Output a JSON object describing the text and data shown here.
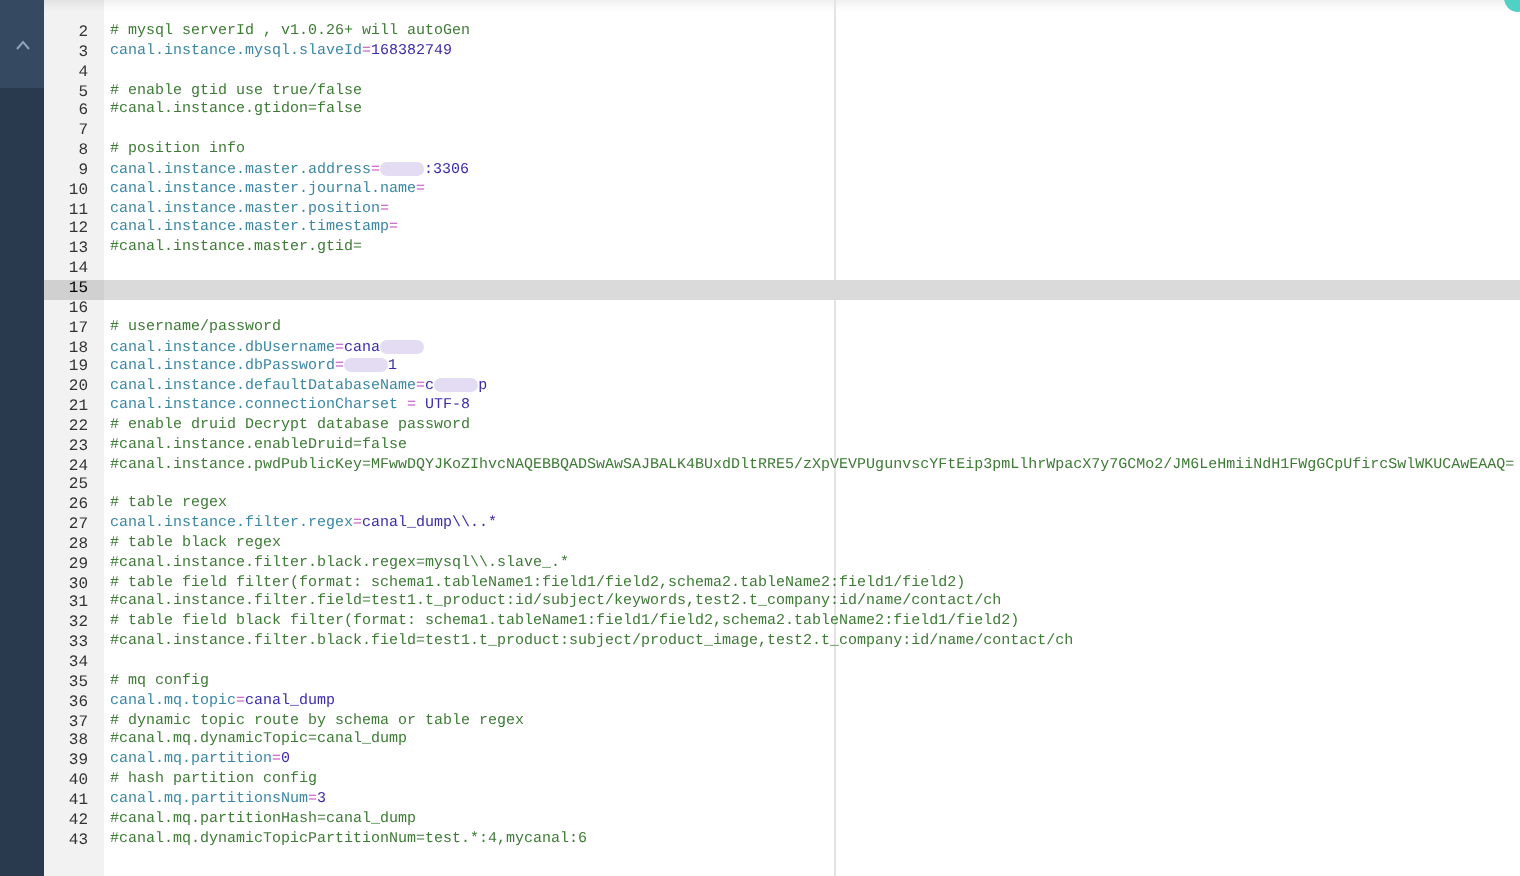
{
  "editor": {
    "lines": [
      {
        "number": "2",
        "kind": "comment",
        "text": "# mysql serverId , v1.0.26+ will autoGen",
        "selected": false
      },
      {
        "number": "3",
        "kind": "property",
        "key": "canal.instance.mysql.slaveId",
        "op": "=",
        "value": "168382749",
        "selected": false
      },
      {
        "number": "4",
        "kind": "blank",
        "selected": false
      },
      {
        "number": "5",
        "kind": "comment",
        "text": "# enable gtid use true/false",
        "selected": false
      },
      {
        "number": "6",
        "kind": "comment",
        "text": "#canal.instance.gtidon=false",
        "selected": false
      },
      {
        "number": "7",
        "kind": "blank",
        "selected": false
      },
      {
        "number": "8",
        "kind": "comment",
        "text": "# position info",
        "selected": false
      },
      {
        "number": "9",
        "kind": "property",
        "key": "canal.instance.master.address",
        "op": "=",
        "masked": true,
        "tail": ":3306",
        "selected": false
      },
      {
        "number": "10",
        "kind": "property",
        "key": "canal.instance.master.journal.name",
        "op": "=",
        "selected": false
      },
      {
        "number": "11",
        "kind": "property",
        "key": "canal.instance.master.position",
        "op": "=",
        "selected": false
      },
      {
        "number": "12",
        "kind": "property",
        "key": "canal.instance.master.timestamp",
        "op": "=",
        "selected": false
      },
      {
        "number": "13",
        "kind": "comment",
        "text": "#canal.instance.master.gtid=",
        "selected": false
      },
      {
        "number": "14",
        "kind": "blank",
        "selected": false
      },
      {
        "number": "15",
        "kind": "blank",
        "selected": true
      },
      {
        "number": "16",
        "kind": "blank",
        "selected": false
      },
      {
        "number": "17",
        "kind": "comment",
        "text": "# username/password",
        "selected": false
      },
      {
        "number": "18",
        "kind": "property",
        "key": "canal.instance.dbUsername",
        "op": "=",
        "value": "cana",
        "masked": true,
        "selected": false
      },
      {
        "number": "19",
        "kind": "property",
        "key": "canal.instance.dbPassword",
        "op": "=",
        "masked": true,
        "tail": "1",
        "selected": false
      },
      {
        "number": "20",
        "kind": "property",
        "key": "canal.instance.defaultDatabaseName",
        "op": "=",
        "value": "c",
        "masked": true,
        "tail": "p",
        "selected": false
      },
      {
        "number": "21",
        "kind": "property",
        "key": "canal.instance.connectionCharset",
        "op": " = ",
        "value": "UTF-8",
        "selected": false
      },
      {
        "number": "22",
        "kind": "comment",
        "text": "# enable druid Decrypt database password",
        "selected": false
      },
      {
        "number": "23",
        "kind": "comment",
        "text": "#canal.instance.enableDruid=false",
        "selected": false
      },
      {
        "number": "24",
        "kind": "comment",
        "text": "#canal.instance.pwdPublicKey=MFwwDQYJKoZIhvcNAQEBBQADSwAwSAJBALK4BUxdDltRRE5/zXpVEVPUgunvscYFtEip3pmLlhrWpacX7y7GCMo2/JM6LeHmiiNdH1FWgGCpUfircSwlWKUCAwEAAQ=",
        "selected": false
      },
      {
        "number": "25",
        "kind": "blank",
        "selected": false
      },
      {
        "number": "26",
        "kind": "comment",
        "text": "# table regex",
        "selected": false
      },
      {
        "number": "27",
        "kind": "property",
        "key": "canal.instance.filter.regex",
        "op": "=",
        "value": "canal_dump\\\\..*",
        "selected": false
      },
      {
        "number": "28",
        "kind": "comment",
        "text": "# table black regex",
        "selected": false
      },
      {
        "number": "29",
        "kind": "comment",
        "text": "#canal.instance.filter.black.regex=mysql\\\\.slave_.*",
        "selected": false
      },
      {
        "number": "30",
        "kind": "comment",
        "text": "# table field filter(format: schema1.tableName1:field1/field2,schema2.tableName2:field1/field2)",
        "selected": false
      },
      {
        "number": "31",
        "kind": "comment",
        "text": "#canal.instance.filter.field=test1.t_product:id/subject/keywords,test2.t_company:id/name/contact/ch",
        "selected": false
      },
      {
        "number": "32",
        "kind": "comment",
        "text": "# table field black filter(format: schema1.tableName1:field1/field2,schema2.tableName2:field1/field2)",
        "selected": false
      },
      {
        "number": "33",
        "kind": "comment",
        "text": "#canal.instance.filter.black.field=test1.t_product:subject/product_image,test2.t_company:id/name/contact/ch",
        "selected": false
      },
      {
        "number": "34",
        "kind": "blank",
        "selected": false
      },
      {
        "number": "35",
        "kind": "comment",
        "text": "# mq config",
        "selected": false
      },
      {
        "number": "36",
        "kind": "property",
        "key": "canal.mq.topic",
        "op": "=",
        "value": "canal_dump",
        "selected": false
      },
      {
        "number": "37",
        "kind": "comment",
        "text": "# dynamic topic route by schema or table regex",
        "selected": false
      },
      {
        "number": "38",
        "kind": "comment",
        "text": "#canal.mq.dynamicTopic=canal_dump",
        "selected": false
      },
      {
        "number": "39",
        "kind": "property",
        "key": "canal.mq.partition",
        "op": "=",
        "value": "0",
        "selected": false
      },
      {
        "number": "40",
        "kind": "comment",
        "text": "# hash partition config",
        "selected": false
      },
      {
        "number": "41",
        "kind": "property",
        "key": "canal.mq.partitionsNum",
        "op": "=",
        "value": "3",
        "selected": false
      },
      {
        "number": "42",
        "kind": "comment",
        "text": "#canal.mq.partitionHash=canal_dump",
        "selected": false
      },
      {
        "number": "43",
        "kind": "comment",
        "text": "#canal.mq.dynamicTopicPartitionNum=test.*:4,mycanal:6",
        "selected": false
      }
    ]
  }
}
